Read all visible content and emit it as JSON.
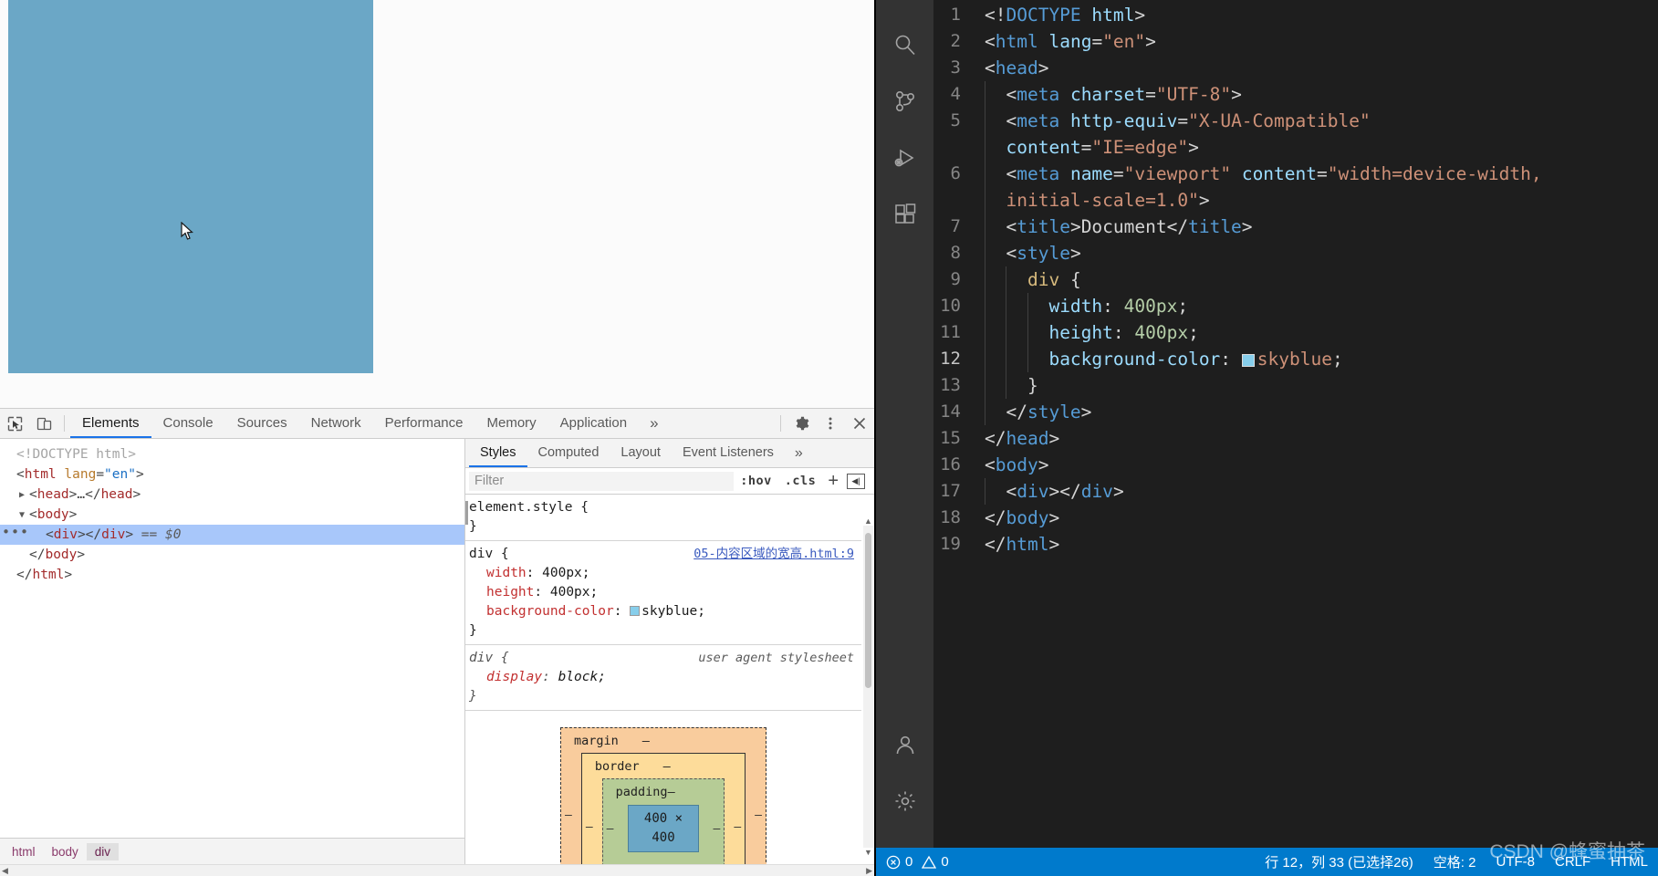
{
  "browser": {
    "viewport": {
      "element_name": "skyblue-div",
      "bg_color": "#6ba7c6"
    }
  },
  "devtools": {
    "toolbar_icons": [
      "inspect-element-icon",
      "device-toolbar-icon"
    ],
    "tabs": [
      {
        "label": "Elements",
        "active": true
      },
      {
        "label": "Console",
        "active": false
      },
      {
        "label": "Sources",
        "active": false
      },
      {
        "label": "Network",
        "active": false
      },
      {
        "label": "Performance",
        "active": false
      },
      {
        "label": "Memory",
        "active": false
      },
      {
        "label": "Application",
        "active": false
      }
    ],
    "more_tabs_label": "»",
    "right_icons": [
      "gear-icon",
      "kebab-menu-icon",
      "close-icon"
    ],
    "dom_tree": [
      {
        "indent": 0,
        "twisty": "",
        "selected": false,
        "tokens": [
          {
            "cls": "tk-doctype",
            "t": "<!DOCTYPE html>"
          }
        ]
      },
      {
        "indent": 0,
        "twisty": "",
        "selected": false,
        "tokens": [
          {
            "cls": "tk-punct",
            "t": "<"
          },
          {
            "cls": "tk-tag",
            "t": "html"
          },
          {
            "cls": "tk-punct",
            "t": " "
          },
          {
            "cls": "tk-attr",
            "t": "lang"
          },
          {
            "cls": "tk-punct",
            "t": "="
          },
          {
            "cls": "tk-val",
            "t": "\"en\""
          },
          {
            "cls": "tk-punct",
            "t": ">"
          }
        ]
      },
      {
        "indent": 1,
        "twisty": "▶",
        "selected": false,
        "tokens": [
          {
            "cls": "tk-punct",
            "t": "<"
          },
          {
            "cls": "tk-tag",
            "t": "head"
          },
          {
            "cls": "tk-punct",
            "t": ">…</"
          },
          {
            "cls": "tk-tag",
            "t": "head"
          },
          {
            "cls": "tk-punct",
            "t": ">"
          }
        ]
      },
      {
        "indent": 1,
        "twisty": "▼",
        "selected": false,
        "tokens": [
          {
            "cls": "tk-punct",
            "t": "<"
          },
          {
            "cls": "tk-tag",
            "t": "body"
          },
          {
            "cls": "tk-punct",
            "t": ">"
          }
        ]
      },
      {
        "indent": 2,
        "twisty": "",
        "selected": true,
        "dots": "•••",
        "tokens": [
          {
            "cls": "tk-punct",
            "t": "<"
          },
          {
            "cls": "tk-tag",
            "t": "div"
          },
          {
            "cls": "tk-punct",
            "t": "></"
          },
          {
            "cls": "tk-tag",
            "t": "div"
          },
          {
            "cls": "tk-punct",
            "t": ">"
          },
          {
            "cls": "tk-ref",
            "t": "  == $0"
          }
        ]
      },
      {
        "indent": 1,
        "twisty": "",
        "selected": false,
        "tokens": [
          {
            "cls": "tk-punct",
            "t": "</"
          },
          {
            "cls": "tk-tag",
            "t": "body"
          },
          {
            "cls": "tk-punct",
            "t": ">"
          }
        ]
      },
      {
        "indent": 0,
        "twisty": "",
        "selected": false,
        "tokens": [
          {
            "cls": "tk-punct",
            "t": "</"
          },
          {
            "cls": "tk-tag",
            "t": "html"
          },
          {
            "cls": "tk-punct",
            "t": ">"
          }
        ]
      }
    ],
    "breadcrumb": [
      {
        "label": "html",
        "active": false
      },
      {
        "label": "body",
        "active": false
      },
      {
        "label": "div",
        "active": true
      }
    ],
    "styles_pane": {
      "tabs": [
        {
          "label": "Styles",
          "active": true
        },
        {
          "label": "Computed",
          "active": false
        },
        {
          "label": "Layout",
          "active": false
        },
        {
          "label": "Event Listeners",
          "active": false
        }
      ],
      "more_tabs_label": "»",
      "filter_placeholder": "Filter",
      "filter_value": "",
      "hov_label": ":hov",
      "cls_label": ".cls",
      "plus_label": "+",
      "rules": [
        {
          "selector": "element.style",
          "source": "",
          "source_kind": "",
          "declarations": []
        },
        {
          "selector": "div",
          "source": "05-内容区域的宽高.html:9",
          "source_kind": "link",
          "declarations": [
            {
              "prop": "width",
              "value": "400px",
              "swatch": false
            },
            {
              "prop": "height",
              "value": "400px",
              "swatch": false
            },
            {
              "prop": "background-color",
              "value": "skyblue",
              "swatch": true,
              "swatch_color": "#87ceeb"
            }
          ]
        },
        {
          "selector": "div",
          "source": "user agent stylesheet",
          "source_kind": "ua",
          "declarations": [
            {
              "prop": "display",
              "value": "block",
              "swatch": false
            }
          ]
        }
      ],
      "box_model": {
        "margin_label": "margin",
        "margin_value": "–",
        "border_label": "border",
        "border_value": "–",
        "padding_label": "padding",
        "padding_value": "–",
        "content_size": "400 × 400",
        "dash": "–"
      }
    }
  },
  "vscode": {
    "activitybar_icons": [
      "search-icon",
      "source-control-icon",
      "run-and-debug-icon",
      "extensions-icon"
    ],
    "activitybar_bottom_icons": [
      "account-icon",
      "settings-gear-icon"
    ],
    "editor": {
      "current_line": 12,
      "selected_line": 12,
      "lines": [
        {
          "n": 1,
          "indent": 0,
          "tokens": [
            {
              "cls": "c-punct",
              "t": "<!"
            },
            {
              "cls": "c-tag",
              "t": "DOCTYPE"
            },
            {
              "cls": "c-txt",
              "t": " "
            },
            {
              "cls": "c-name",
              "t": "html"
            },
            {
              "cls": "c-punct",
              "t": ">"
            }
          ]
        },
        {
          "n": 2,
          "indent": 0,
          "tokens": [
            {
              "cls": "c-punct",
              "t": "<"
            },
            {
              "cls": "c-tag",
              "t": "html"
            },
            {
              "cls": "c-txt",
              "t": " "
            },
            {
              "cls": "c-name",
              "t": "lang"
            },
            {
              "cls": "c-punct",
              "t": "="
            },
            {
              "cls": "c-str",
              "t": "\"en\""
            },
            {
              "cls": "c-punct",
              "t": ">"
            }
          ]
        },
        {
          "n": 3,
          "indent": 0,
          "tokens": [
            {
              "cls": "c-punct",
              "t": "<"
            },
            {
              "cls": "c-tag",
              "t": "head"
            },
            {
              "cls": "c-punct",
              "t": ">"
            }
          ]
        },
        {
          "n": 4,
          "indent": 1,
          "tokens": [
            {
              "cls": "c-punct",
              "t": "  <"
            },
            {
              "cls": "c-tag",
              "t": "meta"
            },
            {
              "cls": "c-txt",
              "t": " "
            },
            {
              "cls": "c-name",
              "t": "charset"
            },
            {
              "cls": "c-punct",
              "t": "="
            },
            {
              "cls": "c-str",
              "t": "\"UTF-8\""
            },
            {
              "cls": "c-punct",
              "t": ">"
            }
          ]
        },
        {
          "n": 5,
          "indent": 1,
          "tokens": [
            {
              "cls": "c-punct",
              "t": "  <"
            },
            {
              "cls": "c-tag",
              "t": "meta"
            },
            {
              "cls": "c-txt",
              "t": " "
            },
            {
              "cls": "c-name",
              "t": "http-equiv"
            },
            {
              "cls": "c-punct",
              "t": "="
            },
            {
              "cls": "c-str",
              "t": "\"X-UA-Compatible\""
            }
          ]
        },
        {
          "n": "",
          "indent": 1,
          "tokens": [
            {
              "cls": "c-punct",
              "t": "  "
            },
            {
              "cls": "c-name",
              "t": "content"
            },
            {
              "cls": "c-punct",
              "t": "="
            },
            {
              "cls": "c-str",
              "t": "\"IE=edge\""
            },
            {
              "cls": "c-punct",
              "t": ">"
            }
          ]
        },
        {
          "n": 6,
          "indent": 1,
          "tokens": [
            {
              "cls": "c-punct",
              "t": "  <"
            },
            {
              "cls": "c-tag",
              "t": "meta"
            },
            {
              "cls": "c-txt",
              "t": " "
            },
            {
              "cls": "c-name",
              "t": "name"
            },
            {
              "cls": "c-punct",
              "t": "="
            },
            {
              "cls": "c-str",
              "t": "\"viewport\""
            },
            {
              "cls": "c-txt",
              "t": " "
            },
            {
              "cls": "c-name",
              "t": "content"
            },
            {
              "cls": "c-punct",
              "t": "="
            },
            {
              "cls": "c-str",
              "t": "\"width=device-width,"
            }
          ]
        },
        {
          "n": "",
          "indent": 1,
          "tokens": [
            {
              "cls": "c-punct",
              "t": "  "
            },
            {
              "cls": "c-str",
              "t": "initial-scale=1.0\""
            },
            {
              "cls": "c-punct",
              "t": ">"
            }
          ]
        },
        {
          "n": 7,
          "indent": 1,
          "tokens": [
            {
              "cls": "c-punct",
              "t": "  <"
            },
            {
              "cls": "c-tag",
              "t": "title"
            },
            {
              "cls": "c-punct",
              "t": ">"
            },
            {
              "cls": "c-txt",
              "t": "Document"
            },
            {
              "cls": "c-punct",
              "t": "</"
            },
            {
              "cls": "c-tag",
              "t": "title"
            },
            {
              "cls": "c-punct",
              "t": ">"
            }
          ]
        },
        {
          "n": 8,
          "indent": 1,
          "tokens": [
            {
              "cls": "c-punct",
              "t": "  <"
            },
            {
              "cls": "c-tag",
              "t": "style"
            },
            {
              "cls": "c-punct",
              "t": ">"
            }
          ]
        },
        {
          "n": 9,
          "indent": 2,
          "tokens": [
            {
              "cls": "c-punct",
              "t": "    "
            },
            {
              "cls": "c-sel",
              "t": "div"
            },
            {
              "cls": "c-punct",
              "t": " {"
            }
          ]
        },
        {
          "n": 10,
          "indent": 3,
          "tokens": [
            {
              "cls": "c-punct",
              "t": "      "
            },
            {
              "cls": "c-prop",
              "t": "width"
            },
            {
              "cls": "c-punct",
              "t": ": "
            },
            {
              "cls": "c-num",
              "t": "400px"
            },
            {
              "cls": "c-punct",
              "t": ";"
            }
          ]
        },
        {
          "n": 11,
          "indent": 3,
          "tokens": [
            {
              "cls": "c-punct",
              "t": "      "
            },
            {
              "cls": "c-prop",
              "t": "height"
            },
            {
              "cls": "c-punct",
              "t": ": "
            },
            {
              "cls": "c-num",
              "t": "400px"
            },
            {
              "cls": "c-punct",
              "t": ";"
            }
          ]
        },
        {
          "n": 12,
          "indent": 3,
          "selected": true,
          "tokens": [
            {
              "cls": "c-punct",
              "t": "      "
            },
            {
              "cls": "c-prop",
              "t": "background-color"
            },
            {
              "cls": "c-punct",
              "t": ": "
            },
            {
              "cls": "swatch",
              "t": ""
            },
            {
              "cls": "c-cssval",
              "t": "skyblue"
            },
            {
              "cls": "c-punct",
              "t": ";"
            }
          ]
        },
        {
          "n": 13,
          "indent": 2,
          "tokens": [
            {
              "cls": "c-punct",
              "t": "    }"
            }
          ]
        },
        {
          "n": 14,
          "indent": 1,
          "tokens": [
            {
              "cls": "c-punct",
              "t": "  </"
            },
            {
              "cls": "c-tag",
              "t": "style"
            },
            {
              "cls": "c-punct",
              "t": ">"
            }
          ]
        },
        {
          "n": 15,
          "indent": 0,
          "tokens": [
            {
              "cls": "c-punct",
              "t": "</"
            },
            {
              "cls": "c-tag",
              "t": "head"
            },
            {
              "cls": "c-punct",
              "t": ">"
            }
          ]
        },
        {
          "n": 16,
          "indent": 0,
          "tokens": [
            {
              "cls": "c-punct",
              "t": "<"
            },
            {
              "cls": "c-tag",
              "t": "body"
            },
            {
              "cls": "c-punct",
              "t": ">"
            }
          ]
        },
        {
          "n": 17,
          "indent": 1,
          "tokens": [
            {
              "cls": "c-punct",
              "t": "  <"
            },
            {
              "cls": "c-tag",
              "t": "div"
            },
            {
              "cls": "c-punct",
              "t": "></"
            },
            {
              "cls": "c-tag",
              "t": "div"
            },
            {
              "cls": "c-punct",
              "t": ">"
            }
          ]
        },
        {
          "n": 18,
          "indent": 0,
          "tokens": [
            {
              "cls": "c-punct",
              "t": "</"
            },
            {
              "cls": "c-tag",
              "t": "body"
            },
            {
              "cls": "c-punct",
              "t": ">"
            }
          ]
        },
        {
          "n": 19,
          "indent": 0,
          "tokens": [
            {
              "cls": "c-punct",
              "t": "</"
            },
            {
              "cls": "c-tag",
              "t": "html"
            },
            {
              "cls": "c-punct",
              "t": ">"
            }
          ]
        }
      ]
    },
    "statusbar": {
      "errors": "0",
      "warnings": "0",
      "cursor": "行 12，列 33 (已选择26)",
      "indentation": "空格: 2",
      "encoding": "UTF-8",
      "eol": "CRLF",
      "language": "HTML",
      "accent_color": "#007acc"
    },
    "watermark": "CSDN @蜂蜜抽茶"
  }
}
